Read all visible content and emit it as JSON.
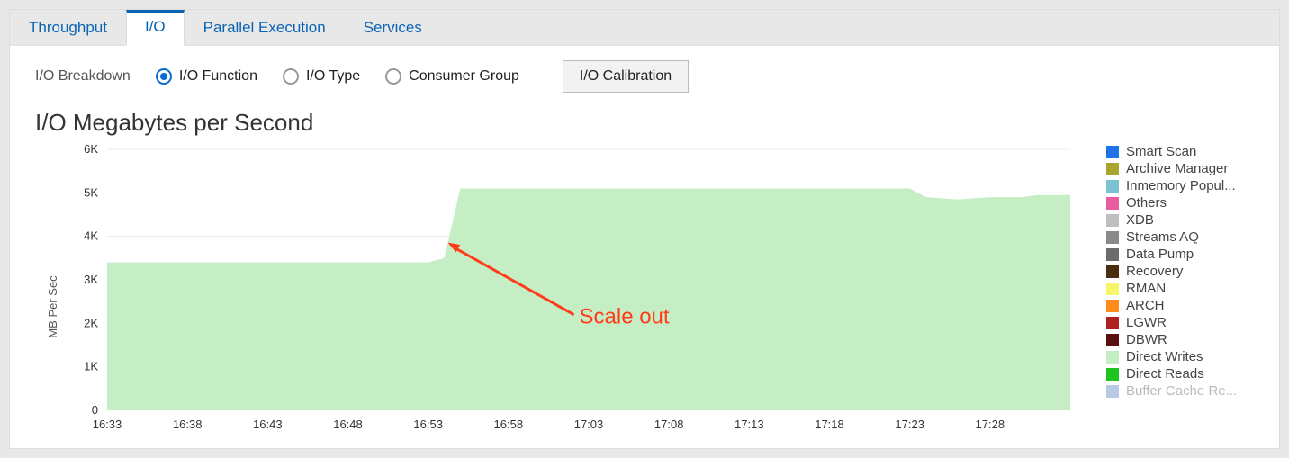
{
  "tabs": [
    {
      "label": "Throughput",
      "active": false
    },
    {
      "label": "I/O",
      "active": true
    },
    {
      "label": "Parallel Execution",
      "active": false
    },
    {
      "label": "Services",
      "active": false
    }
  ],
  "controls": {
    "breakdown_label": "I/O Breakdown",
    "radios": [
      {
        "label": "I/O Function",
        "checked": true
      },
      {
        "label": "I/O Type",
        "checked": false
      },
      {
        "label": "Consumer Group",
        "checked": false
      }
    ],
    "calibration_button": "I/O Calibration"
  },
  "chart_title": "I/O Megabytes per Second",
  "annotation": "Scale out",
  "legend": [
    {
      "name": "Smart Scan",
      "color": "#1e73e8"
    },
    {
      "name": "Archive Manager",
      "color": "#a6a62e"
    },
    {
      "name": "Inmemory Popul...",
      "color": "#7bc3d2"
    },
    {
      "name": "Others",
      "color": "#e85ca0"
    },
    {
      "name": "XDB",
      "color": "#bfbfbf"
    },
    {
      "name": "Streams AQ",
      "color": "#8a8a8a"
    },
    {
      "name": "Data Pump",
      "color": "#6b6b6b"
    },
    {
      "name": "Recovery",
      "color": "#4a2e0d"
    },
    {
      "name": "RMAN",
      "color": "#f7f56b"
    },
    {
      "name": "ARCH",
      "color": "#ff8c1a"
    },
    {
      "name": "LGWR",
      "color": "#b02020"
    },
    {
      "name": "DBWR",
      "color": "#5a1010"
    },
    {
      "name": "Direct Writes",
      "color": "#c5eec4"
    },
    {
      "name": "Direct Reads",
      "color": "#1fc421"
    },
    {
      "name": "Buffer Cache Re...",
      "color": "#b9c9e8"
    }
  ],
  "chart_data": {
    "type": "area",
    "title": "I/O Megabytes per Second",
    "ylabel": "MB Per Sec",
    "xlabel": "",
    "ylim": [
      0,
      6000
    ],
    "y_ticks": [
      0,
      1000,
      2000,
      3000,
      4000,
      5000,
      6000
    ],
    "y_tick_labels": [
      "0",
      "1K",
      "2K",
      "3K",
      "4K",
      "5K",
      "6K"
    ],
    "x_tick_labels": [
      "16:33",
      "16:38",
      "16:43",
      "16:48",
      "16:53",
      "16:58",
      "17:03",
      "17:08",
      "17:13",
      "17:18",
      "17:23",
      "17:28"
    ],
    "dominant_series": "Direct Writes",
    "series": [
      {
        "name": "Direct Writes",
        "color": "#c5eec4",
        "x": [
          "16:33",
          "16:38",
          "16:43",
          "16:48",
          "16:53",
          "16:54",
          "16:55",
          "16:58",
          "17:03",
          "17:08",
          "17:13",
          "17:18",
          "17:23",
          "17:24",
          "17:26",
          "17:28",
          "17:30",
          "17:31",
          "17:33"
        ],
        "values": [
          3400,
          3400,
          3400,
          3400,
          3400,
          3500,
          5100,
          5100,
          5100,
          5100,
          5100,
          5100,
          5100,
          4900,
          4850,
          4900,
          4900,
          4950,
          4950
        ]
      }
    ],
    "annotations": [
      {
        "text": "Scale out",
        "approx_x": "16:54",
        "approx_y": 3400,
        "kind": "arrow-label"
      }
    ]
  }
}
